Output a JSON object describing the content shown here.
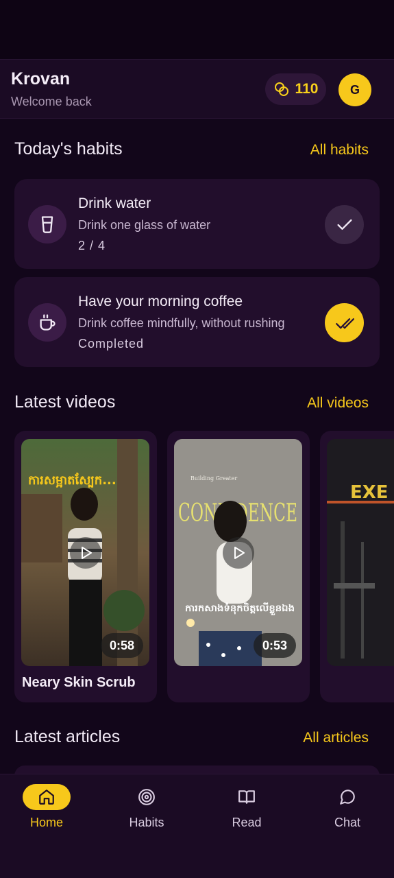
{
  "header": {
    "user_name": "Krovan",
    "welcome": "Welcome back",
    "coins": "110",
    "coin_icon": "coins-icon",
    "avatar_initial": "G"
  },
  "habits_section": {
    "title": "Today's habits",
    "link": "All habits",
    "items": [
      {
        "title": "Drink water",
        "description": "Drink one glass of water",
        "progress": "2 / 4",
        "icon": "glass-icon",
        "status": "pending"
      },
      {
        "title": "Have your morning coffee",
        "description": "Drink coffee mindfully, without rushing",
        "progress": "Completed",
        "icon": "coffee-cup-icon",
        "status": "completed"
      }
    ]
  },
  "videos_section": {
    "title": "Latest videos",
    "link": "All videos",
    "items": [
      {
        "title": "Neary Skin Scrub",
        "duration": "0:58",
        "thumb_text": "ការសម្អាតស្បែក..."
      },
      {
        "title": "",
        "duration": "0:53",
        "thumb_text": "CONFIDENCE",
        "thumb_subtext": "Building Greater",
        "thumb_caption": "ការកសាងទំនុកចិត្តលើខ្លួនឯង"
      },
      {
        "title": "",
        "duration": "",
        "thumb_text": "EXE"
      }
    ]
  },
  "articles_section": {
    "title": "Latest articles",
    "link": "All articles"
  },
  "bottom_nav": {
    "items": [
      {
        "label": "Home",
        "icon": "home-icon",
        "active": true
      },
      {
        "label": "Habits",
        "icon": "target-icon",
        "active": false
      },
      {
        "label": "Read",
        "icon": "book-icon",
        "active": false
      },
      {
        "label": "Chat",
        "icon": "chat-bubble-icon",
        "active": false
      }
    ]
  },
  "colors": {
    "background": "#12061a",
    "card": "#220e2c",
    "accent": "#f7c81b",
    "text": "#f1e9f5"
  }
}
